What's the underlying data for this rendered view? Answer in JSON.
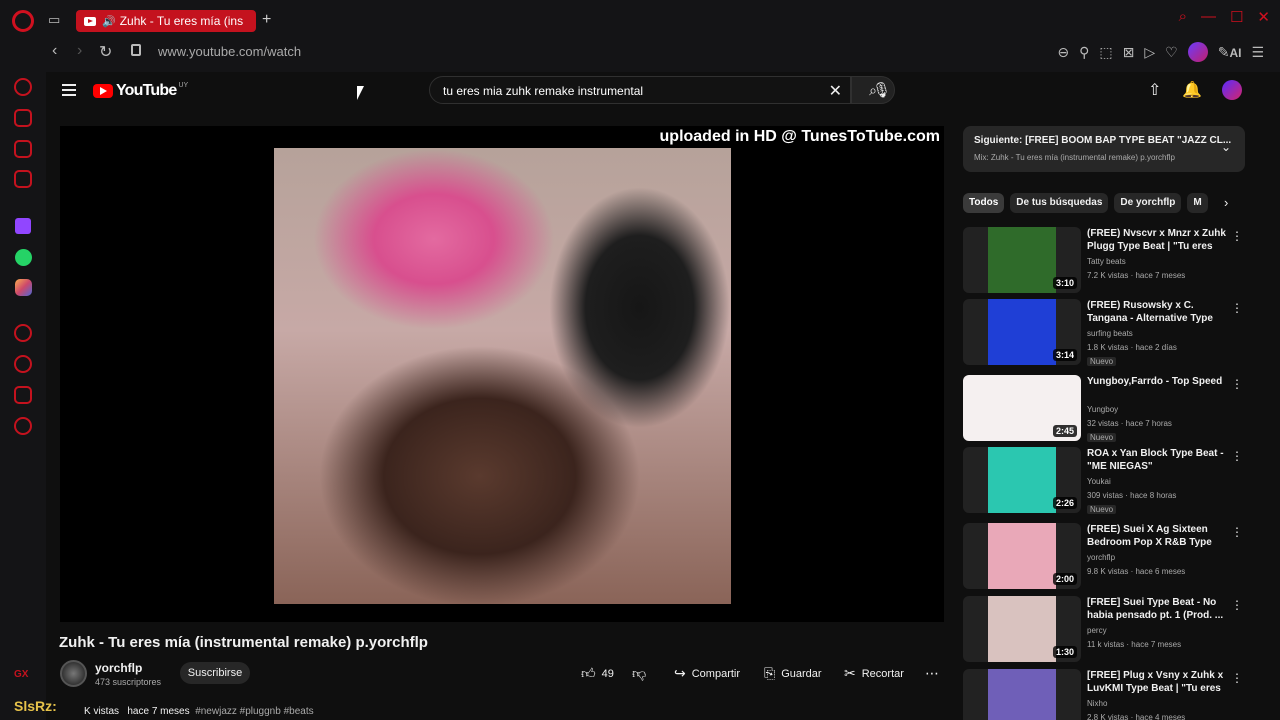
{
  "browser": {
    "tab_title": "Zuhk - Tu eres mía (ins",
    "url": "www.youtube.com/watch",
    "ai_label": "AI",
    "sidebar_bottom_label": "GX"
  },
  "youtube": {
    "logo_text": "YouTube",
    "country_code": "UY",
    "search_query": "tu eres mia zuhk remake instrumental"
  },
  "player": {
    "watermark": "uploaded in HD @ TunesToTube.com"
  },
  "video": {
    "title": "Zuhk - Tu eres mía (instrumental remake) p.yorchflp",
    "channel": "yorchflp",
    "subscribers": "473 suscriptores",
    "subscribe_label": "Suscribirse",
    "likes": "49",
    "share_label": "Compartir",
    "save_label": "Guardar",
    "clip_label": "Recortar",
    "views": "K vistas",
    "age": "hace 7 meses",
    "tags": "#newjazz #pluggnb #beats"
  },
  "overlay_text": "SlsRz:",
  "up_next": {
    "title": "Siguiente: [FREE] BOOM BAP TYPE BEAT \"JAZZ CL...",
    "subtitle": "Mix: Zuhk - Tu eres mía (instrumental remake) p.yorchflp"
  },
  "chips": [
    "Todos",
    "De tus búsquedas",
    "De yorchflp",
    "M"
  ],
  "recommendations": [
    {
      "title": "(FREE) Nvscvr x Mnzr x Zuhk Plugg Type Beat | \"Tu eres mía...",
      "channel": "Tatty beats",
      "views": "7.2 K vistas · hace 7 meses",
      "badge": "",
      "duration": "3:10",
      "thumb_color": "#2f6b2a"
    },
    {
      "title": "(FREE) Rusowsky x C. Tangana - Alternative Type Beat - \"BIEN :?\"",
      "channel": "surfing beats",
      "views": "1.8 K vistas · hace 2 días",
      "badge": "Nuevo",
      "duration": "3:14",
      "thumb_color": "#1f3fd6"
    },
    {
      "title": "Yungboy,Farrdo - Top Speed",
      "channel": "Yungboy",
      "views": "32 vistas · hace 7 horas",
      "badge": "Nuevo",
      "duration": "2:45",
      "thumb_color": "#f5f0f0"
    },
    {
      "title": "ROA x Yan Block Type Beat - \"ME NIEGAS\"",
      "channel": "Youkai",
      "views": "309 vistas · hace 8 horas",
      "badge": "Nuevo",
      "duration": "2:26",
      "thumb_color": "#2bc7b0"
    },
    {
      "title": "(FREE) Suei X Ag Sixteen Bedroom Pop X R&B Type Bea...",
      "channel": "yorchflp",
      "views": "9.8 K vistas · hace 6 meses",
      "badge": "",
      "duration": "2:00",
      "thumb_color": "#e9a8b8"
    },
    {
      "title": "[FREE] Suei Type Beat - No habia pensado pt. 1 (Prod. ...",
      "channel": "percy",
      "views": "11 k vistas · hace 7 meses",
      "badge": "",
      "duration": "1:30",
      "thumb_color": "#d9c2bf"
    },
    {
      "title": "[FREE] Plug x Vsny x Zuhk x LuvKMI Type Beat | \"Tu eres ...",
      "channel": "Nixho",
      "views": "2.8 K vistas · hace 4 meses",
      "badge": "",
      "duration": "",
      "thumb_color": "#6f5fb8"
    }
  ],
  "icons": {
    "brand_red": "#c4121e",
    "yt_red": "#ff0000"
  }
}
